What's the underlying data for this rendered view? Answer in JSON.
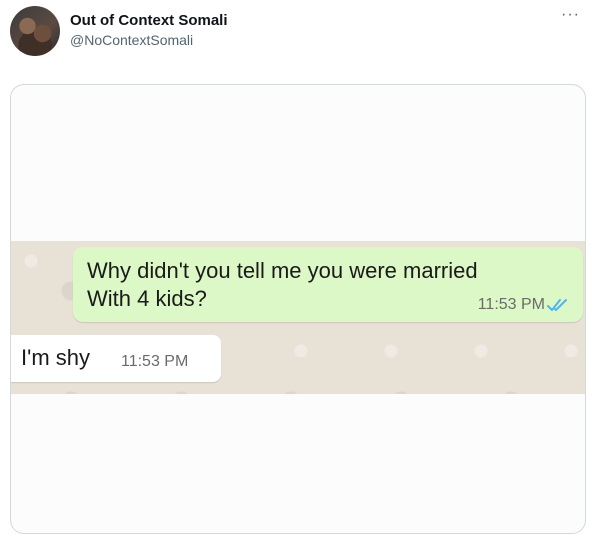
{
  "tweet": {
    "display_name": "Out of Context Somali",
    "handle": "@NoContextSomali",
    "more": "···"
  },
  "chat": {
    "outgoing": {
      "text": "Why didn't you tell me you were married\nWith 4 kids?",
      "time": "11:53 PM",
      "status_icon": "double-check-icon",
      "status_color": "#4fb6ec"
    },
    "incoming": {
      "text": "I'm shy",
      "time": "11:53 PM"
    }
  },
  "colors": {
    "outgoing_bubble": "#dcf8c6",
    "incoming_bubble": "#ffffff",
    "chat_background": "#e7e1d6"
  }
}
